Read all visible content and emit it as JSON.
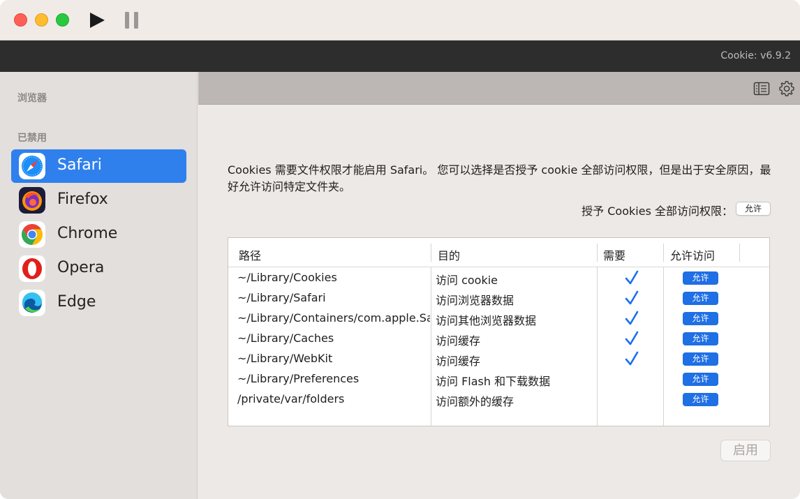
{
  "version": "Cookie: v6.9.2",
  "sidebar": {
    "browsers_label": "浏览器",
    "disabled_label": "已禁用",
    "items": [
      {
        "label": "Safari",
        "icon": "safari-icon"
      },
      {
        "label": "Firefox",
        "icon": "firefox-icon"
      },
      {
        "label": "Chrome",
        "icon": "chrome-icon"
      },
      {
        "label": "Opera",
        "icon": "opera-icon"
      },
      {
        "label": "Edge",
        "icon": "edge-icon"
      }
    ]
  },
  "content": {
    "description": "Cookies 需要文件权限才能启用 Safari。 您可以选择是否授予 cookie 全部访问权限，但是出于安全原因，最好允许访问特定文件夹。",
    "grant_label": "授予 Cookies 全部访问权限：",
    "grant_button": "允许",
    "table": {
      "headers": {
        "path": "路径",
        "purpose": "目的",
        "required": "需要",
        "allow": "允许访问"
      },
      "rows": [
        {
          "path": "~/Library/Cookies",
          "purpose": "访问 cookie",
          "required": true,
          "button": "允许"
        },
        {
          "path": "~/Library/Safari",
          "purpose": "访问浏览器数据",
          "required": true,
          "button": "允许"
        },
        {
          "path": "~/Library/Containers/com.apple.Safari",
          "purpose": "访问其他浏览器数据",
          "required": true,
          "button": "允许"
        },
        {
          "path": "~/Library/Caches",
          "purpose": "访问缓存",
          "required": true,
          "button": "允许"
        },
        {
          "path": "~/Library/WebKit",
          "purpose": "访问缓存",
          "required": true,
          "button": "允许"
        },
        {
          "path": "~/Library/Preferences",
          "purpose": "访问 Flash 和下载数据",
          "required": false,
          "button": "允许"
        },
        {
          "path": "/private/var/folders",
          "purpose": "访问额外的缓存",
          "required": false,
          "button": "允许"
        }
      ]
    },
    "enable_button": "启用"
  },
  "colors": {
    "accent": "#2f80ed",
    "allow_button": "#1f6fe5",
    "check": "#1a6ff0"
  }
}
